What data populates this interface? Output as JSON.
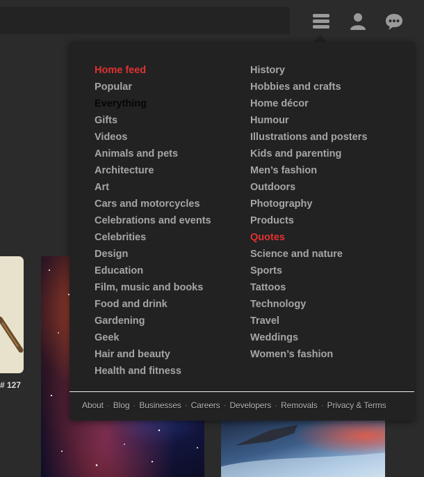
{
  "header": {
    "icons": [
      "menu-icon",
      "user-icon",
      "chat-icon"
    ]
  },
  "background": {
    "pin_count": "# 127"
  },
  "menu": {
    "left_column": [
      {
        "label": "Home feed",
        "state": "active"
      },
      {
        "label": "Popular"
      },
      {
        "label": "Everything",
        "state": "dark"
      },
      {
        "label": "Gifts"
      },
      {
        "label": "Videos"
      },
      {
        "label": "Animals and pets"
      },
      {
        "label": "Architecture"
      },
      {
        "label": "Art"
      },
      {
        "label": "Cars and motorcycles"
      },
      {
        "label": "Celebrations and events"
      },
      {
        "label": "Celebrities"
      },
      {
        "label": "Design"
      },
      {
        "label": "Education"
      },
      {
        "label": "Film, music and books"
      },
      {
        "label": "Food and drink"
      },
      {
        "label": "Gardening"
      },
      {
        "label": "Geek"
      },
      {
        "label": "Hair and beauty"
      },
      {
        "label": "Health and fitness"
      }
    ],
    "right_column": [
      {
        "label": "History"
      },
      {
        "label": "Hobbies and crafts"
      },
      {
        "label": "Home décor"
      },
      {
        "label": "Humour"
      },
      {
        "label": "Illustrations and posters"
      },
      {
        "label": "Kids and parenting"
      },
      {
        "label": "Men’s fashion"
      },
      {
        "label": "Outdoors"
      },
      {
        "label": "Photography"
      },
      {
        "label": "Products"
      },
      {
        "label": "Quotes",
        "state": "active"
      },
      {
        "label": "Science and nature"
      },
      {
        "label": "Sports"
      },
      {
        "label": "Tattoos"
      },
      {
        "label": "Technology"
      },
      {
        "label": "Travel"
      },
      {
        "label": "Weddings"
      },
      {
        "label": "Women’s fashion"
      }
    ],
    "footer": [
      "About",
      "Blog",
      "Businesses",
      "Careers",
      "Developers",
      "Removals",
      "Privacy & Terms"
    ],
    "footer_separator": "·"
  },
  "colors": {
    "accent": "#e03232",
    "link": "#a6a6a6",
    "panel": "#222222",
    "page_bg": "#2b2b2b"
  }
}
